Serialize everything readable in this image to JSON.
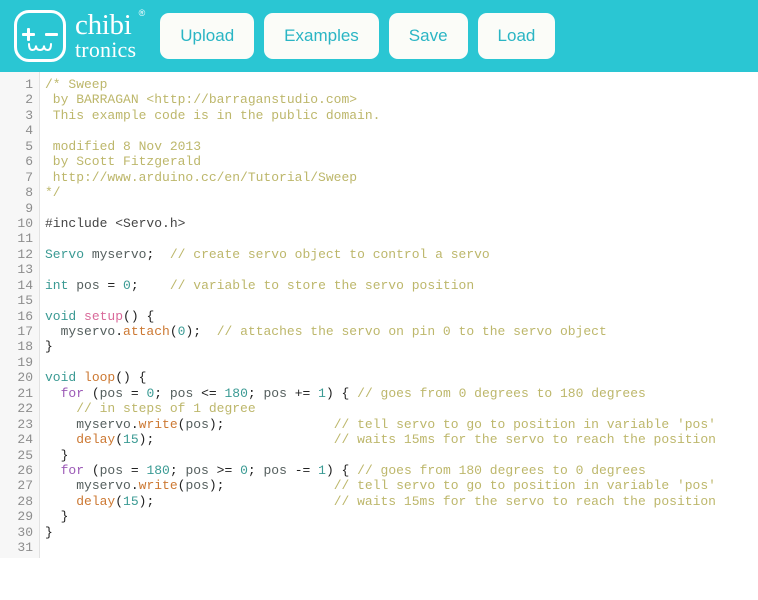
{
  "app": {
    "brand_primary": "chibi",
    "brand_secondary": "tronics",
    "brand_registered": "®",
    "theme_color": "#2ac6d3",
    "button_bg": "#fbfcf8",
    "button_text_color": "#2ab5c4"
  },
  "toolbar": {
    "buttons": [
      {
        "label": "Upload",
        "name": "upload-button"
      },
      {
        "label": "Examples",
        "name": "examples-button"
      },
      {
        "label": "Save",
        "name": "save-button"
      },
      {
        "label": "Load",
        "name": "load-button"
      }
    ]
  },
  "editor": {
    "language": "arduino-c",
    "total_lines": 31,
    "line_numbers": [
      "1",
      "2",
      "3",
      "4",
      "5",
      "6",
      "7",
      "8",
      "9",
      "10",
      "11",
      "12",
      "13",
      "14",
      "15",
      "16",
      "17",
      "18",
      "19",
      "20",
      "21",
      "22",
      "23",
      "24",
      "25",
      "26",
      "27",
      "28",
      "29",
      "30",
      "31"
    ],
    "code_plain": [
      "/* Sweep",
      " by BARRAGAN <http://barraganstudio.com>",
      " This example code is in the public domain.",
      "",
      " modified 8 Nov 2013",
      " by Scott Fitzgerald",
      " http://www.arduino.cc/en/Tutorial/Sweep",
      "*/",
      "",
      "#include <Servo.h>",
      "",
      "Servo myservo;  // create servo object to control a servo",
      "",
      "int pos = 0;    // variable to store the servo position",
      "",
      "void setup() {",
      "  myservo.attach(0);  // attaches the servo on pin 0 to the servo object",
      "}",
      "",
      "void loop() {",
      "  for (pos = 0; pos <= 180; pos += 1) { // goes from 0 degrees to 180 degrees",
      "    // in steps of 1 degree",
      "    myservo.write(pos);              // tell servo to go to position in variable 'pos'",
      "    delay(15);                       // waits 15ms for the servo to reach the position",
      "  }",
      "  for (pos = 180; pos >= 0; pos -= 1) { // goes from 180 degrees to 0 degrees",
      "    myservo.write(pos);              // tell servo to go to position in variable 'pos'",
      "    delay(15);                       // waits 15ms for the servo to reach the position",
      "  }",
      "}",
      ""
    ],
    "code_tokens": [
      [
        [
          "/* Sweep",
          "comment"
        ]
      ],
      [
        [
          " by BARRAGAN <http://barraganstudio.com>",
          "comment"
        ]
      ],
      [
        [
          " This example code is in the public domain.",
          "comment"
        ]
      ],
      [],
      [
        [
          " modified 8 Nov 2013",
          "comment"
        ]
      ],
      [
        [
          " by Scott Fitzgerald",
          "comment"
        ]
      ],
      [
        [
          " http://www.arduino.cc/en/Tutorial/Sweep",
          "comment"
        ]
      ],
      [
        [
          "*/",
          "comment"
        ]
      ],
      [],
      [
        [
          "#include <Servo.h>",
          "pre"
        ]
      ],
      [],
      [
        [
          "Servo",
          "type"
        ],
        [
          " ",
          "plain"
        ],
        [
          "myservo",
          "ident"
        ],
        [
          ";",
          "punct"
        ],
        [
          "  ",
          "plain"
        ],
        [
          "// create servo object to control a servo",
          "comment"
        ]
      ],
      [],
      [
        [
          "int",
          "type"
        ],
        [
          " ",
          "plain"
        ],
        [
          "pos",
          "ident"
        ],
        [
          " = ",
          "punct"
        ],
        [
          "0",
          "num"
        ],
        [
          ";",
          "punct"
        ],
        [
          "    ",
          "plain"
        ],
        [
          "// variable to store the servo position",
          "comment"
        ]
      ],
      [],
      [
        [
          "void",
          "type"
        ],
        [
          " ",
          "plain"
        ],
        [
          "setup",
          "fn2"
        ],
        [
          "() {",
          "punct"
        ]
      ],
      [
        [
          "  ",
          "plain"
        ],
        [
          "myservo",
          "ident"
        ],
        [
          ".",
          "punct"
        ],
        [
          "attach",
          "fn"
        ],
        [
          "(",
          "punct"
        ],
        [
          "0",
          "num"
        ],
        [
          ");",
          "punct"
        ],
        [
          "  ",
          "plain"
        ],
        [
          "// attaches the servo on pin 0 to the servo object",
          "comment"
        ]
      ],
      [
        [
          "}",
          "punct"
        ]
      ],
      [],
      [
        [
          "void",
          "type"
        ],
        [
          " ",
          "plain"
        ],
        [
          "loop",
          "fn"
        ],
        [
          "() {",
          "punct"
        ]
      ],
      [
        [
          "  ",
          "plain"
        ],
        [
          "for",
          "kw"
        ],
        [
          " (",
          "punct"
        ],
        [
          "pos",
          "ident"
        ],
        [
          " = ",
          "punct"
        ],
        [
          "0",
          "num"
        ],
        [
          "; ",
          "punct"
        ],
        [
          "pos",
          "ident"
        ],
        [
          " <= ",
          "punct"
        ],
        [
          "180",
          "num"
        ],
        [
          "; ",
          "punct"
        ],
        [
          "pos",
          "ident"
        ],
        [
          " += ",
          "punct"
        ],
        [
          "1",
          "num"
        ],
        [
          ") { ",
          "punct"
        ],
        [
          "// goes from 0 degrees to 180 degrees",
          "comment"
        ]
      ],
      [
        [
          "    ",
          "plain"
        ],
        [
          "// in steps of 1 degree",
          "comment"
        ]
      ],
      [
        [
          "    ",
          "plain"
        ],
        [
          "myservo",
          "ident"
        ],
        [
          ".",
          "punct"
        ],
        [
          "write",
          "fn"
        ],
        [
          "(",
          "punct"
        ],
        [
          "pos",
          "ident"
        ],
        [
          ");",
          "punct"
        ],
        [
          "              ",
          "plain"
        ],
        [
          "// tell servo to go to position in variable 'pos'",
          "comment"
        ]
      ],
      [
        [
          "    ",
          "plain"
        ],
        [
          "delay",
          "fn"
        ],
        [
          "(",
          "punct"
        ],
        [
          "15",
          "num"
        ],
        [
          ");",
          "punct"
        ],
        [
          "                       ",
          "plain"
        ],
        [
          "// waits 15ms for the servo to reach the position",
          "comment"
        ]
      ],
      [
        [
          "  ",
          "plain"
        ],
        [
          "}",
          "punct"
        ]
      ],
      [
        [
          "  ",
          "plain"
        ],
        [
          "for",
          "kw"
        ],
        [
          " (",
          "punct"
        ],
        [
          "pos",
          "ident"
        ],
        [
          " = ",
          "punct"
        ],
        [
          "180",
          "num"
        ],
        [
          "; ",
          "punct"
        ],
        [
          "pos",
          "ident"
        ],
        [
          " >= ",
          "punct"
        ],
        [
          "0",
          "num"
        ],
        [
          "; ",
          "punct"
        ],
        [
          "pos",
          "ident"
        ],
        [
          " -= ",
          "punct"
        ],
        [
          "1",
          "num"
        ],
        [
          ") { ",
          "punct"
        ],
        [
          "// goes from 180 degrees to 0 degrees",
          "comment"
        ]
      ],
      [
        [
          "    ",
          "plain"
        ],
        [
          "myservo",
          "ident"
        ],
        [
          ".",
          "punct"
        ],
        [
          "write",
          "fn"
        ],
        [
          "(",
          "punct"
        ],
        [
          "pos",
          "ident"
        ],
        [
          ");",
          "punct"
        ],
        [
          "              ",
          "plain"
        ],
        [
          "// tell servo to go to position in variable 'pos'",
          "comment"
        ]
      ],
      [
        [
          "    ",
          "plain"
        ],
        [
          "delay",
          "fn"
        ],
        [
          "(",
          "punct"
        ],
        [
          "15",
          "num"
        ],
        [
          ");",
          "punct"
        ],
        [
          "                       ",
          "plain"
        ],
        [
          "// waits 15ms for the servo to reach the position",
          "comment"
        ]
      ],
      [
        [
          "  ",
          "plain"
        ],
        [
          "}",
          "punct"
        ]
      ],
      [
        [
          "}",
          "punct"
        ]
      ],
      []
    ],
    "colors": {
      "comment": "#bdb76b",
      "type": "#3a9a93",
      "keyword": "#9b59b6",
      "function": "#cc7832",
      "function_alt": "#d96a9a",
      "identifier": "#555f5e",
      "number": "#3a9a93",
      "gutter_bg": "#f7f7f7",
      "gutter_text": "#8d8d8d"
    }
  }
}
